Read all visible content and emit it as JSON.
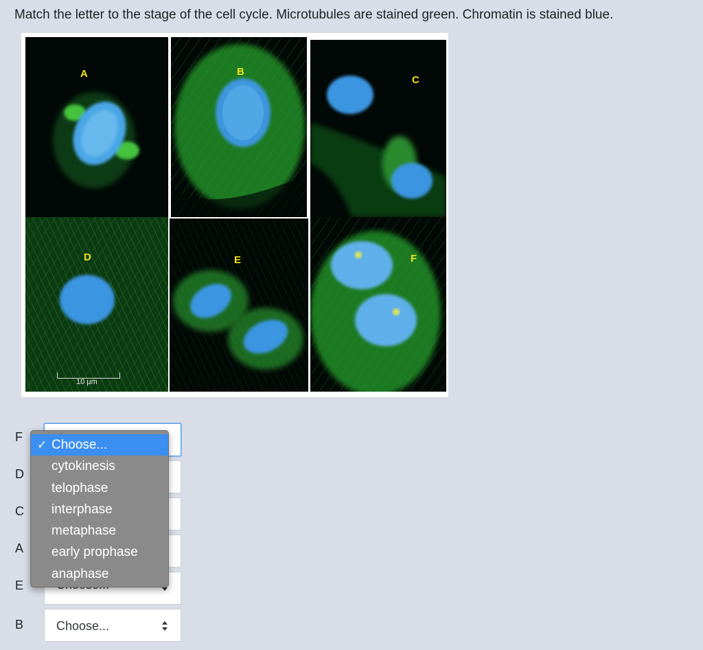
{
  "question": "Match the letter to the stage of the cell cycle. Microtubules are stained green. Chromatin is stained blue.",
  "figure": {
    "panel_labels": [
      "A",
      "B",
      "C",
      "D",
      "E",
      "F"
    ],
    "scale_bar": "10 μm"
  },
  "rows": [
    {
      "letter": "F",
      "value": "Choose...",
      "open": true
    },
    {
      "letter": "D",
      "value": "Choose..."
    },
    {
      "letter": "C",
      "value": "Choose..."
    },
    {
      "letter": "A",
      "value": "Choose..."
    },
    {
      "letter": "E",
      "value": "Choose..."
    },
    {
      "letter": "B",
      "value": "Choose..."
    }
  ],
  "dropdown": {
    "check_icon": "✓",
    "options": [
      "Choose...",
      "cytokinesis",
      "telophase",
      "interphase",
      "metaphase",
      "early prophase",
      "anaphase"
    ],
    "selected_index": 0
  },
  "colors": {
    "microtubules": "#2fa83a",
    "chromatin": "#3aa0e8",
    "focus_border": "#5ea0e6",
    "menu_highlight": "#3b8ff0"
  }
}
